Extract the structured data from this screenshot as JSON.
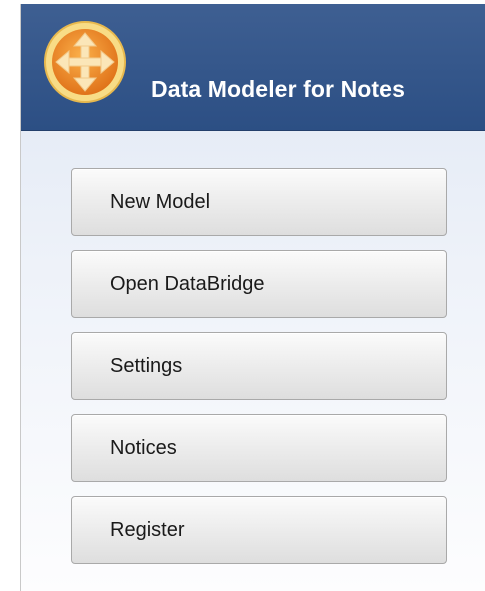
{
  "header": {
    "app_title": "Data Modeler for Notes",
    "logo_icon": "four-way-arrows-icon",
    "colors": {
      "header_bg": "#2f5286",
      "logo_orange": "#f08a24",
      "logo_ring": "#f7d77a"
    }
  },
  "menu": {
    "items": [
      {
        "label": "New Model"
      },
      {
        "label": "Open DataBridge"
      },
      {
        "label": "Settings"
      },
      {
        "label": "Notices"
      },
      {
        "label": "Register"
      }
    ]
  }
}
